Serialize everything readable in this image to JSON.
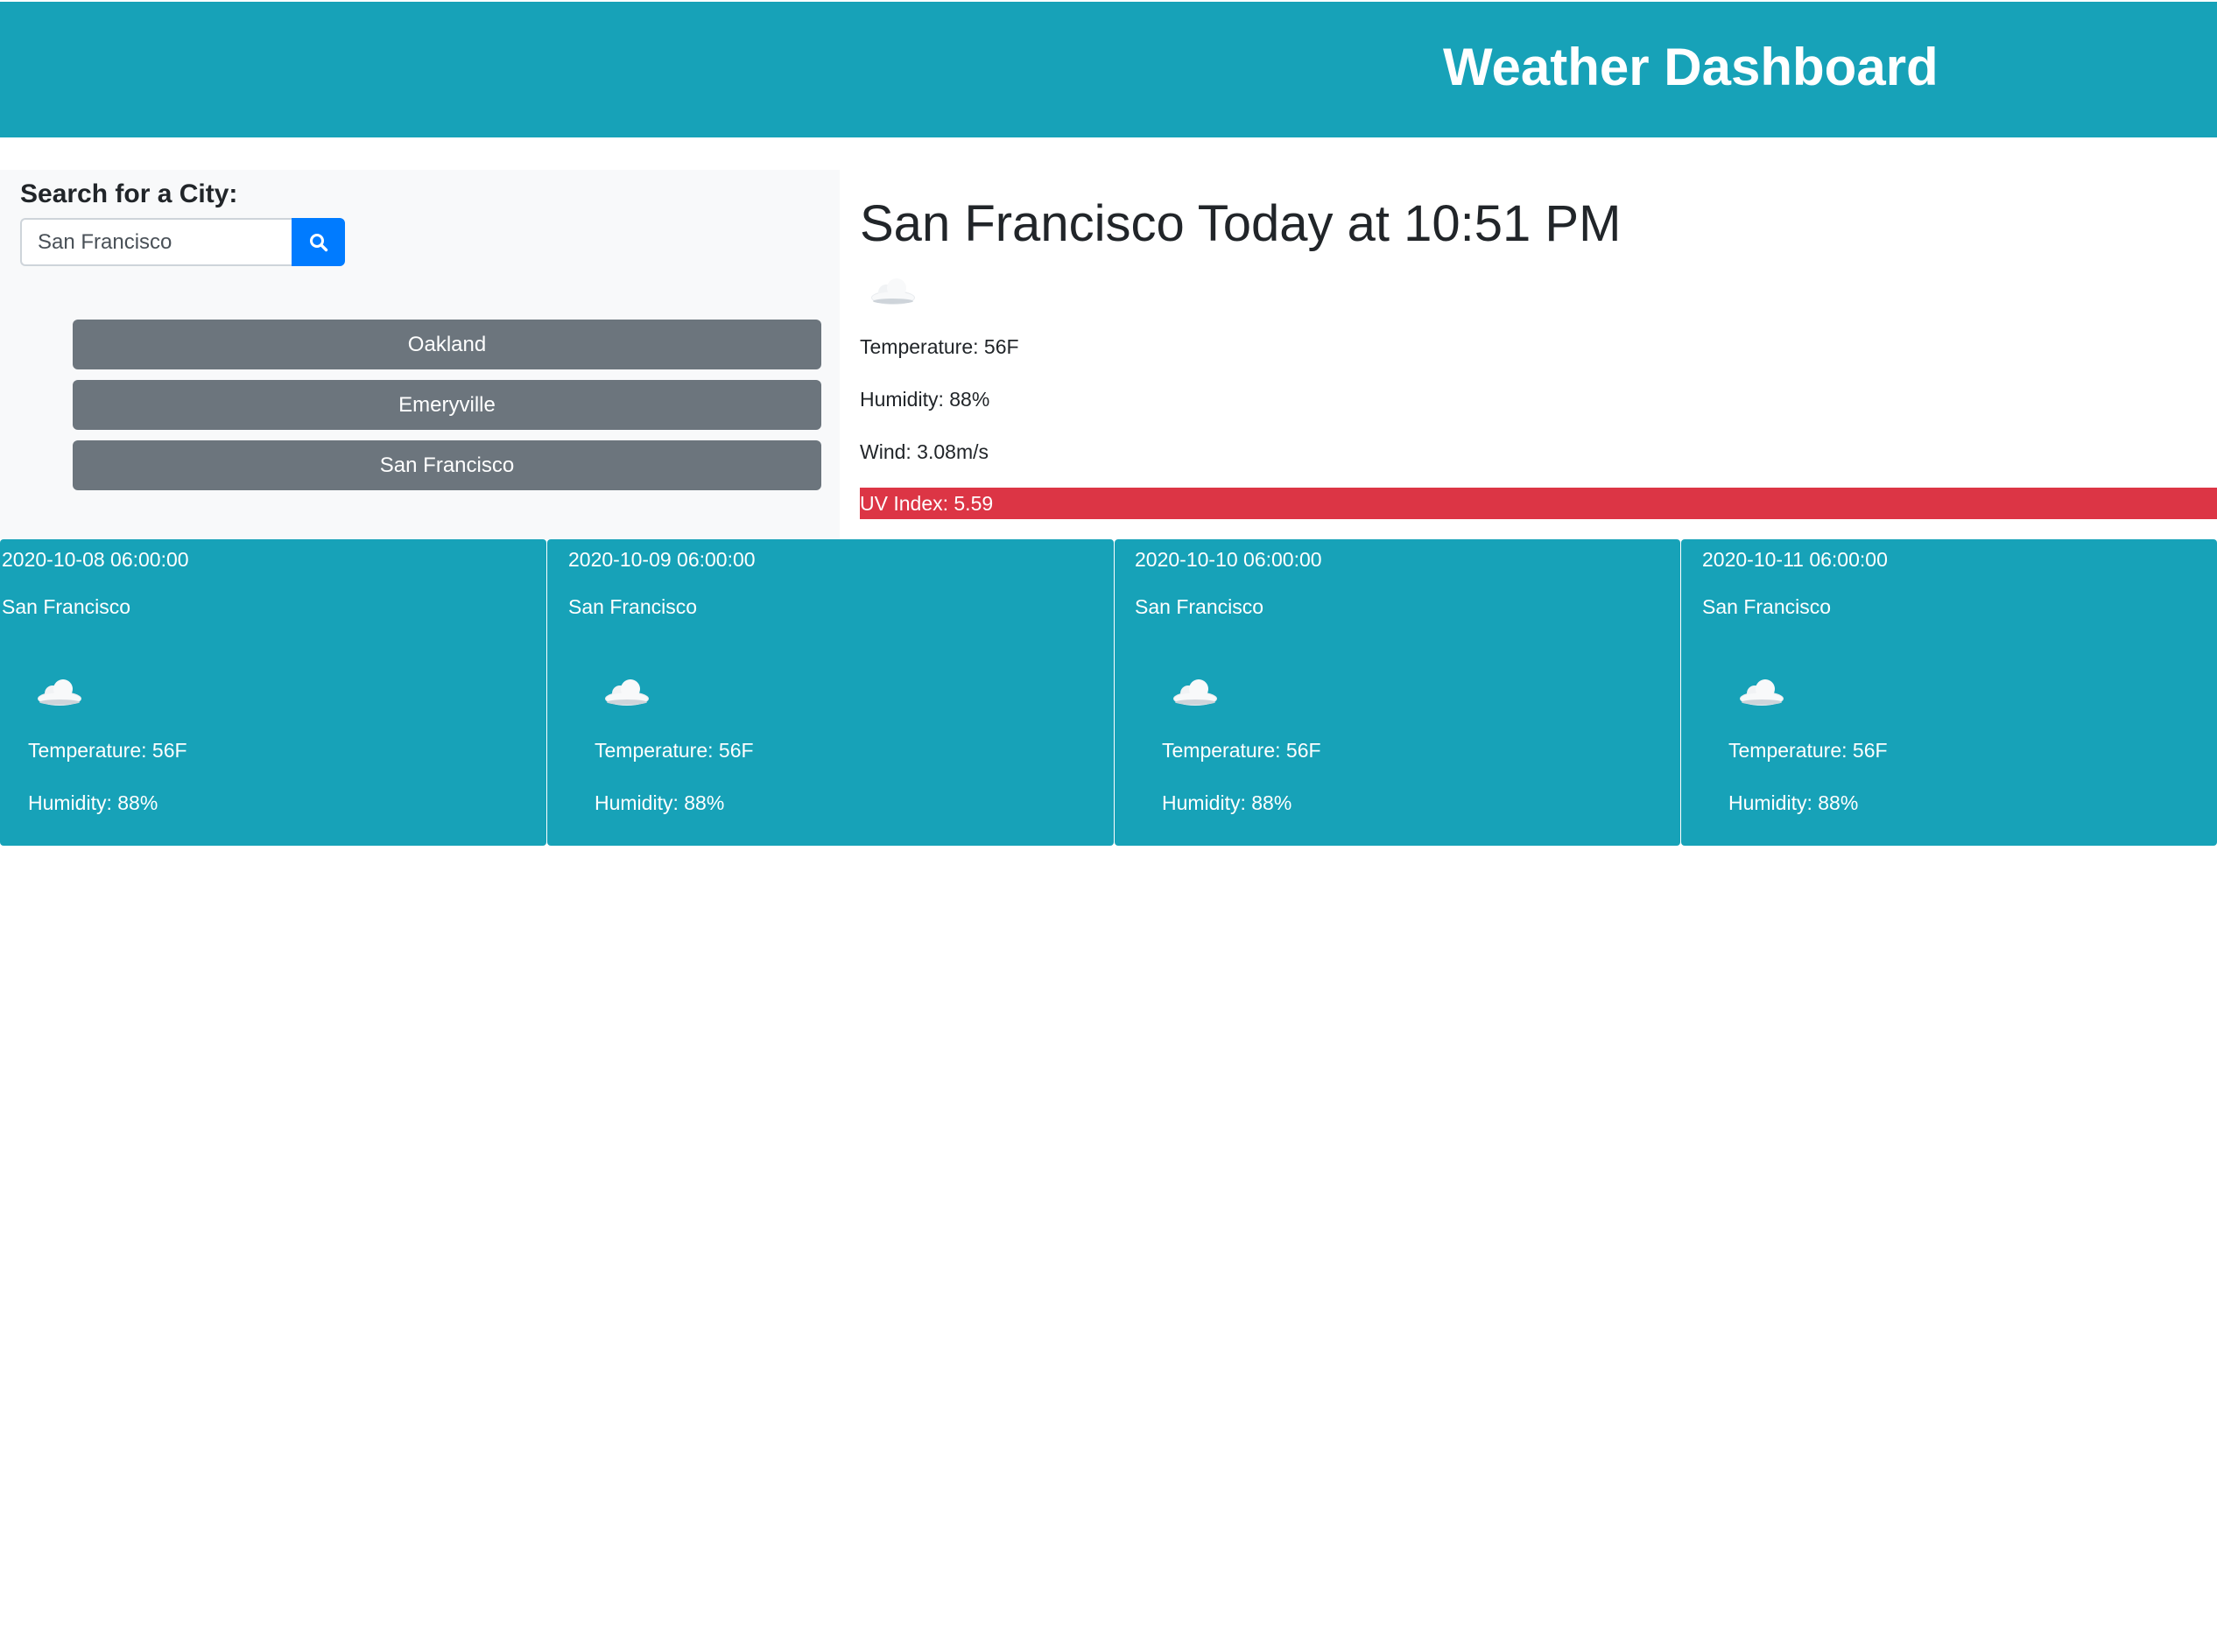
{
  "header": {
    "title": "Weather Dashboard"
  },
  "search": {
    "label": "Search for a City:",
    "value": "San Francisco",
    "placeholder": ""
  },
  "history": [
    {
      "label": "Oakland"
    },
    {
      "label": "Emeryville"
    },
    {
      "label": "San Francisco"
    }
  ],
  "current": {
    "title": "San Francisco Today at 10:51 PM",
    "icon": "cloud-icon",
    "temperature": "Temperature: 56F",
    "humidity": "Humidity: 88%",
    "wind": "Wind: 3.08m/s",
    "uv": "UV Index: 5.59"
  },
  "forecast": [
    {
      "date": "2020-10-08 06:00:00",
      "city": "San Francisco",
      "icon": "cloud-icon",
      "temperature": "Temperature: 56F",
      "humidity": "Humidity: 88%"
    },
    {
      "date": "2020-10-09 06:00:00",
      "city": "San Francisco",
      "icon": "cloud-icon",
      "temperature": "Temperature: 56F",
      "humidity": "Humidity: 88%"
    },
    {
      "date": "2020-10-10 06:00:00",
      "city": "San Francisco",
      "icon": "cloud-icon",
      "temperature": "Temperature: 56F",
      "humidity": "Humidity: 88%"
    },
    {
      "date": "2020-10-11 06:00:00",
      "city": "San Francisco",
      "icon": "cloud-icon",
      "temperature": "Temperature: 56F",
      "humidity": "Humidity: 88%"
    }
  ],
  "colors": {
    "header": "#17a2b8",
    "search_button": "#007bff",
    "history_button": "#6c757d",
    "uv_high": "#dc3545"
  }
}
